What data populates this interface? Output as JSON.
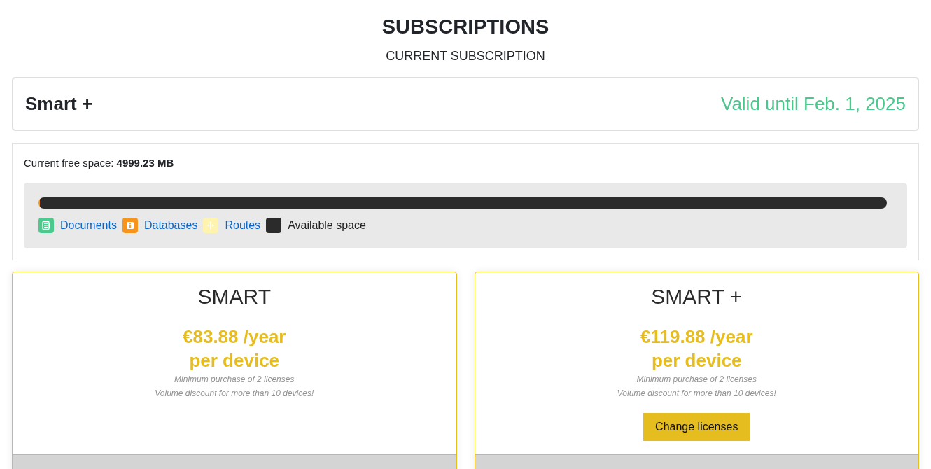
{
  "page": {
    "title": "SUBSCRIPTIONS",
    "subtitle": "CURRENT SUBSCRIPTION"
  },
  "current_subscription": {
    "plan": "Smart +",
    "validity": "Valid until Feb. 1, 2025"
  },
  "storage": {
    "free_space": "Current free space: **4999.23 MB**",
    "legend": [
      {
        "kind": "document",
        "label": "Documents",
        "color": "#4cc98c"
      },
      {
        "kind": "database",
        "label": "Databases",
        "color": "#f7941d",
        "level": 0.002
      },
      {
        "kind": "route",
        "label": "Routes",
        "color": "#fff3b0"
      },
      {
        "kind": "free",
        "label": "Available space",
        "color": "#2b2b2b",
        "level": 0.998
      }
    ]
  },
  "plans": [
    {
      "name": "SMART",
      "price": "€83.88 /year",
      "unit": "per device",
      "notes": [
        "Minimum purchase of 2 licenses",
        "Volume discount for more than 10 devices!"
      ]
    },
    {
      "name": "SMART +",
      "price": "€119.88 /year",
      "unit": "per device",
      "notes": [
        "Minimum purchase of 2 licenses",
        "Volume discount for more than 10 devices!"
      ],
      "button": "Change licenses"
    }
  ]
}
